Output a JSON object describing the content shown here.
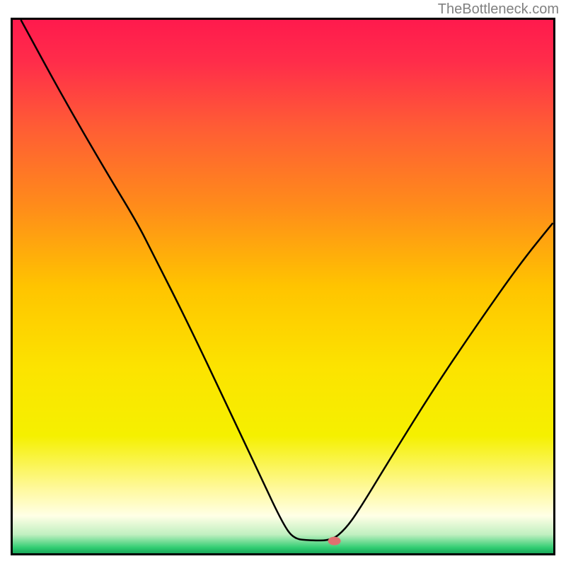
{
  "watermark": "TheBottleneck.com",
  "chart_data": {
    "type": "line",
    "title": "",
    "xlabel": "",
    "ylabel": "",
    "xlim": [
      0,
      100
    ],
    "ylim": [
      0,
      100
    ],
    "gradient_stops": [
      {
        "offset": 0.0,
        "color": "#ff1a4d"
      },
      {
        "offset": 0.08,
        "color": "#ff2d4a"
      },
      {
        "offset": 0.2,
        "color": "#ff5c35"
      },
      {
        "offset": 0.35,
        "color": "#ff8c1a"
      },
      {
        "offset": 0.5,
        "color": "#ffc400"
      },
      {
        "offset": 0.65,
        "color": "#fce300"
      },
      {
        "offset": 0.78,
        "color": "#f5f000"
      },
      {
        "offset": 0.88,
        "color": "#fff99e"
      },
      {
        "offset": 0.93,
        "color": "#ffffe6"
      },
      {
        "offset": 0.965,
        "color": "#c0f0c0"
      },
      {
        "offset": 0.99,
        "color": "#2ecc71"
      },
      {
        "offset": 1.0,
        "color": "#1ba85a"
      }
    ],
    "series": [
      {
        "name": "curve",
        "points": [
          {
            "x": 1.5,
            "y": 100
          },
          {
            "x": 9,
            "y": 86
          },
          {
            "x": 17,
            "y": 72
          },
          {
            "x": 23,
            "y": 62
          },
          {
            "x": 26,
            "y": 56
          },
          {
            "x": 32,
            "y": 44
          },
          {
            "x": 40,
            "y": 27
          },
          {
            "x": 46,
            "y": 14
          },
          {
            "x": 50,
            "y": 5.5
          },
          {
            "x": 52,
            "y": 2.7
          },
          {
            "x": 55,
            "y": 2.4
          },
          {
            "x": 59,
            "y": 2.4
          },
          {
            "x": 61.5,
            "y": 4.5
          },
          {
            "x": 64,
            "y": 8
          },
          {
            "x": 70,
            "y": 18
          },
          {
            "x": 78,
            "y": 31
          },
          {
            "x": 86,
            "y": 43
          },
          {
            "x": 94,
            "y": 54.5
          },
          {
            "x": 100,
            "y": 62
          }
        ]
      }
    ],
    "marker": {
      "x": 59.5,
      "y": 2.3,
      "color": "#e07070"
    }
  }
}
